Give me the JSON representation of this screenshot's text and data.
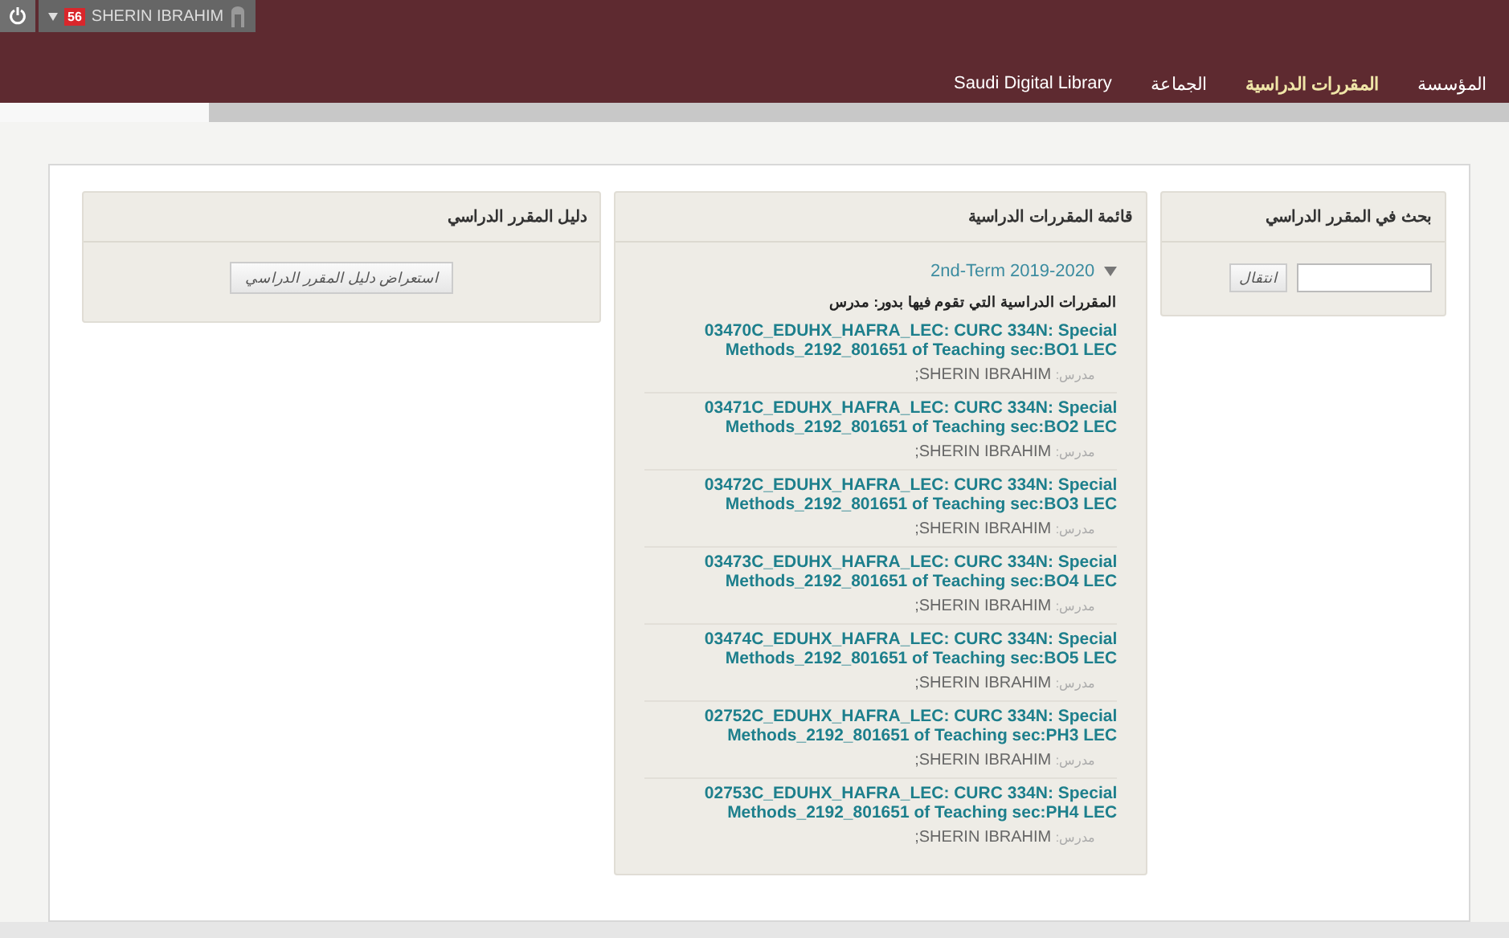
{
  "user_bar": {
    "badge": "56",
    "user_name": "SHERIN IBRAHIM"
  },
  "nav": [
    {
      "label": "المؤسسة",
      "selected": false
    },
    {
      "label": "المقررات الدراسية",
      "selected": true
    },
    {
      "label": "الجماعة",
      "selected": false
    },
    {
      "label": "Saudi Digital Library",
      "selected": false
    }
  ],
  "search_panel": {
    "title": "بحث في المقرر الدراسي",
    "button": "انتقال"
  },
  "course_list": {
    "title": "قائمة المقررات الدراسية",
    "term": {
      "label": "2nd-Term 2019-2020",
      "expanded": true
    },
    "role_heading": "المقررات الدراسية التي تقوم فيها بدور: مدرس",
    "courses": [
      {
        "title": "03470C_EDUHX_HAFRA_LEC: CURC 334N: Special Methods_2192_801651 of Teaching sec:BO1 LEC",
        "instructor_label": "مدرس:",
        "instructor": "SHERIN IBRAHIM;"
      },
      {
        "title": "03471C_EDUHX_HAFRA_LEC: CURC 334N: Special Methods_2192_801651 of Teaching sec:BO2 LEC",
        "instructor_label": "مدرس:",
        "instructor": "SHERIN IBRAHIM;"
      },
      {
        "title": "03472C_EDUHX_HAFRA_LEC: CURC 334N: Special Methods_2192_801651 of Teaching sec:BO3 LEC",
        "instructor_label": "مدرس:",
        "instructor": "SHERIN IBRAHIM;"
      },
      {
        "title": "03473C_EDUHX_HAFRA_LEC: CURC 334N: Special Methods_2192_801651 of Teaching sec:BO4 LEC",
        "instructor_label": "مدرس:",
        "instructor": "SHERIN IBRAHIM;"
      },
      {
        "title": "03474C_EDUHX_HAFRA_LEC: CURC 334N: Special Methods_2192_801651 of Teaching sec:BO5 LEC",
        "instructor_label": "مدرس:",
        "instructor": "SHERIN IBRAHIM;"
      },
      {
        "title": "02752C_EDUHX_HAFRA_LEC: CURC 334N: Special Methods_2192_801651 of Teaching sec:PH3 LEC",
        "instructor_label": "مدرس:",
        "instructor": "SHERIN IBRAHIM;"
      },
      {
        "title": "02753C_EDUHX_HAFRA_LEC: CURC 334N: Special Methods_2192_801651 of Teaching sec:PH4 LEC",
        "instructor_label": "مدرس:",
        "instructor": "SHERIN IBRAHIM;"
      }
    ]
  },
  "syllabus_panel": {
    "title": "دليل المقرر الدراسي",
    "button": "استعراض دليل المقرر الدراسي"
  }
}
